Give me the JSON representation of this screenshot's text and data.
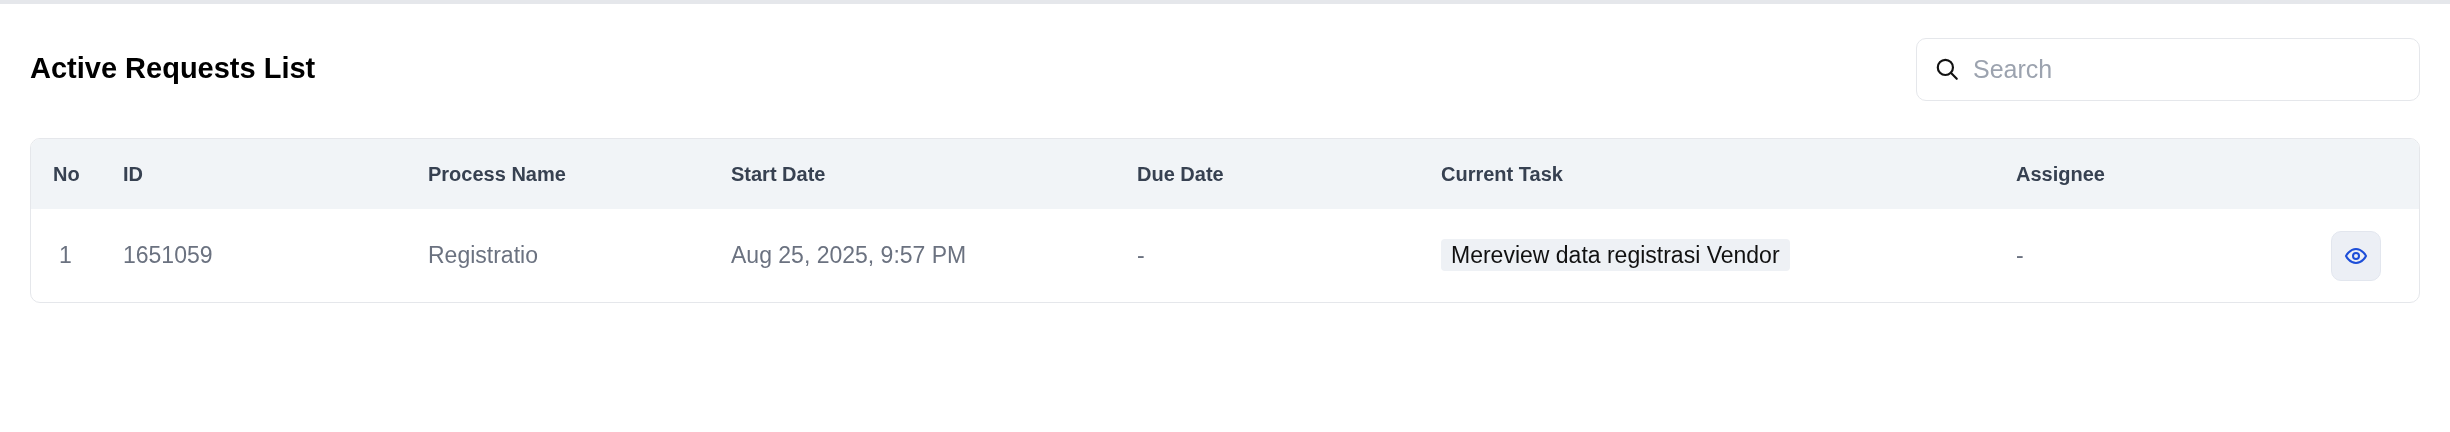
{
  "title": "Active Requests List",
  "search": {
    "placeholder": "Search"
  },
  "table": {
    "columns": [
      "No",
      "ID",
      "Process Name",
      "Start Date",
      "Due Date",
      "Current Task",
      "Assignee"
    ],
    "rows": [
      {
        "no": "1",
        "id": "1651059",
        "process_name": "Registratio",
        "start_date": "Aug 25, 2025, 9:57 PM",
        "due_date": "-",
        "current_task": "Mereview data registrasi Vendor",
        "assignee": "-"
      }
    ]
  }
}
